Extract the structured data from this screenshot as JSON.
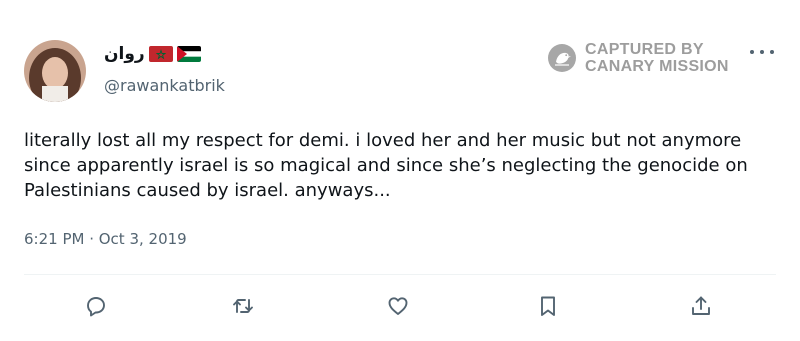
{
  "author": {
    "display_name": "روان",
    "handle": "@rawankatbrik",
    "flags": [
      "morocco-flag",
      "palestine-flag"
    ]
  },
  "watermark": {
    "line1": "CAPTURED BY",
    "line2": "CANARY MISSION",
    "icon": "canary-bird-icon"
  },
  "tweet": {
    "text": "literally lost all my respect for demi. i loved her and her music but not anymore since apparently israel is so magical and since she’s neglecting the genocide on Palestinians caused by israel. anyways...",
    "timestamp": "6:21 PM · Oct 3, 2019"
  },
  "actions": [
    "reply-icon",
    "retweet-icon",
    "like-icon",
    "bookmark-icon",
    "share-icon"
  ],
  "colors": {
    "text": "#0f1419",
    "secondary": "#536471",
    "divider": "#eff3f4",
    "watermark": "#7d7d7d"
  }
}
